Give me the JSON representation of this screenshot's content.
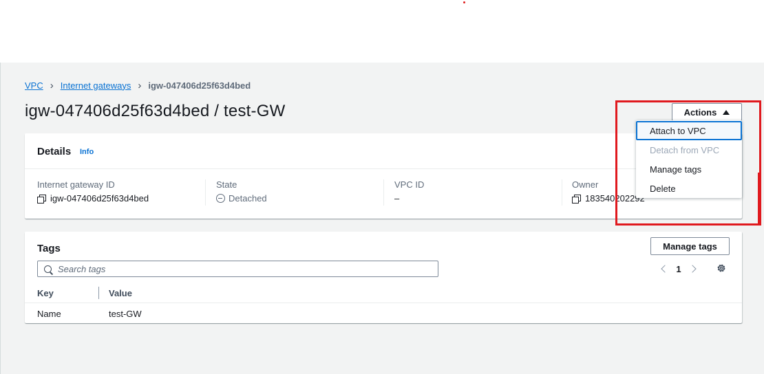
{
  "breadcrumb": {
    "items": [
      "VPC",
      "Internet gateways"
    ],
    "current": "igw-047406d25f63d4bed"
  },
  "page": {
    "title": "igw-047406d25f63d4bed / test-GW"
  },
  "actions": {
    "label": "Actions",
    "menu": [
      "Attach to VPC",
      "Detach from VPC",
      "Manage tags",
      "Delete"
    ]
  },
  "details": {
    "title": "Details",
    "info": "Info",
    "fields": [
      {
        "label": "Internet gateway ID",
        "value": "igw-047406d25f63d4bed"
      },
      {
        "label": "State",
        "value": "Detached"
      },
      {
        "label": "VPC ID",
        "value": "–"
      },
      {
        "label": "Owner",
        "value": "183540202292"
      }
    ]
  },
  "tags": {
    "title": "Tags",
    "manage_label": "Manage tags",
    "search_placeholder": "Search tags",
    "page": "1",
    "columns": [
      "Key",
      "Value"
    ],
    "rows": [
      {
        "key": "Name",
        "value": "test-GW"
      }
    ]
  },
  "colors": {
    "link": "#0972d3",
    "annotation": "#e0191e",
    "background": "#f2f3f3"
  }
}
